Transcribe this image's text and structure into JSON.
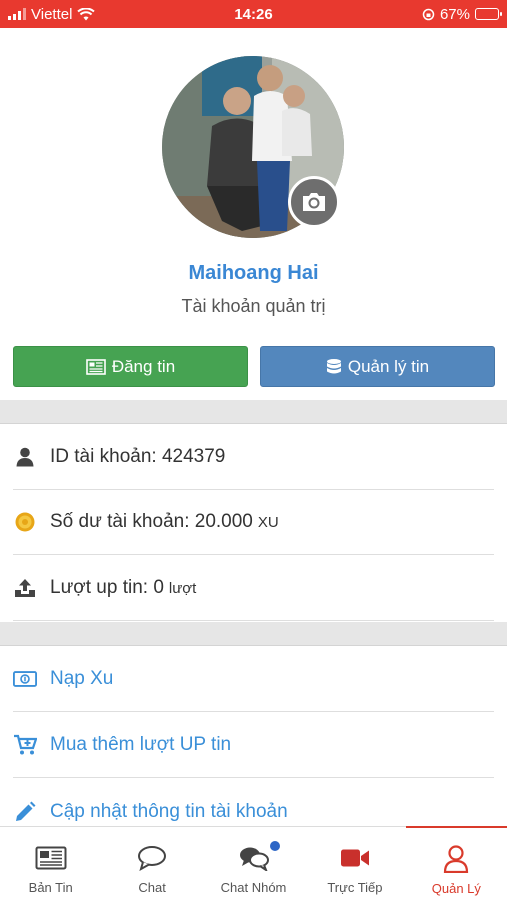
{
  "status_bar": {
    "carrier": "Viettel",
    "time": "14:26",
    "battery": "67%",
    "battery_level": 0.67
  },
  "profile": {
    "name": "Maihoang Hai",
    "role": "Tài khoản quản trị",
    "post_button": "Đăng tin",
    "manage_button": "Quản lý tin"
  },
  "account": {
    "id_label": "ID tài khoản: 424379",
    "balance_label": "Số dư tài khoản: 20.000",
    "balance_unit": "XU",
    "uploads_label": "Lượt up tin: 0",
    "uploads_unit": "lượt"
  },
  "actions": {
    "topup": "Nạp Xu",
    "buy_up": "Mua thêm lượt UP tin",
    "update_info": "Cập nhật thông tin tài khoản"
  },
  "nav": {
    "news": "Bản Tin",
    "chat": "Chat",
    "group_chat": "Chat Nhóm",
    "live": "Trực Tiếp",
    "manage": "Quản Lý"
  },
  "colors": {
    "status_bar": "#e8392f",
    "link": "#3a8fd8",
    "post_button": "#46a352",
    "manage_button": "#5387bd",
    "active_nav": "#d93a2b"
  }
}
